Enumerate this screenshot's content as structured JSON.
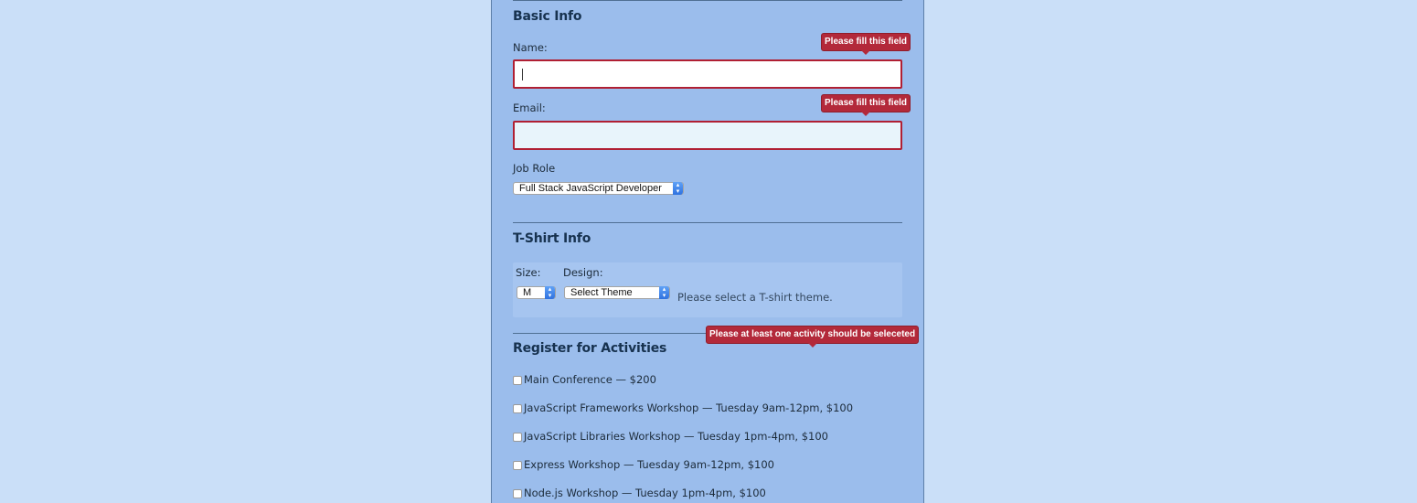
{
  "basic_info": {
    "title": "Basic Info",
    "name_label": "Name:",
    "name_value": "",
    "name_error": "Please fill this field",
    "email_label": "Email:",
    "email_value": "",
    "email_error": "Please fill this field",
    "job_role_label": "Job Role",
    "job_role_selected": "Full Stack JavaScript Developer"
  },
  "tshirt_info": {
    "title": "T-Shirt Info",
    "size_label": "Size:",
    "size_selected": "M",
    "design_label": "Design:",
    "design_selected": "Select Theme",
    "hint": "Please select a T-shirt theme."
  },
  "activities": {
    "title": "Register for Activities",
    "error": "Please at least one activity should be seleceted",
    "items": [
      {
        "label": "Main Conference — $200",
        "checked": false
      },
      {
        "label": "JavaScript Frameworks Workshop — Tuesday 9am-12pm, $100",
        "checked": false
      },
      {
        "label": "JavaScript Libraries Workshop — Tuesday 1pm-4pm, $100",
        "checked": false
      },
      {
        "label": "Express Workshop — Tuesday 9am-12pm, $100",
        "checked": false
      },
      {
        "label": "Node.js Workshop — Tuesday 1pm-4pm, $100",
        "checked": false
      }
    ]
  },
  "colors": {
    "page_bg": "#cadff8",
    "form_bg": "#9bbdec",
    "error_red": "#b3293a"
  }
}
